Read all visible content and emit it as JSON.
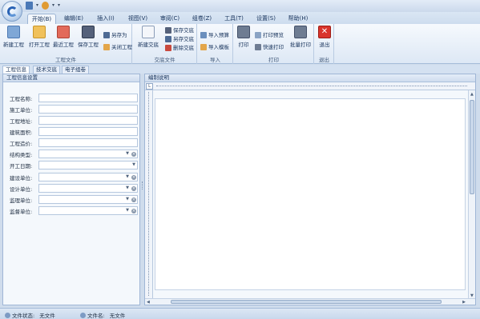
{
  "ribbon_tabs": [
    "开始(B)",
    "编辑(E)",
    "插入(I)",
    "视图(V)",
    "审阅(C)",
    "组卷(Z)",
    "工具(T)",
    "设置(S)",
    "帮助(H)"
  ],
  "groups": {
    "project_file": {
      "label": "工程文件",
      "new": "新建工程",
      "open": "打开工程",
      "recent": "最近工程",
      "save": "保存工程",
      "save_as": "另存为",
      "close": "关闭工程"
    },
    "doc_file": {
      "label": "交底文件",
      "new": "新建交底",
      "save": "保存交底",
      "save_as": "另存交底",
      "delete": "删除交底"
    },
    "import": {
      "label": "导入",
      "budget": "导入预算",
      "template": "导入模板"
    },
    "print": {
      "label": "打印",
      "print": "打印",
      "preview": "打印预览",
      "quick": "快速打印",
      "batch": "批量打印"
    },
    "exit": {
      "label": "退出",
      "exit": "退出"
    }
  },
  "doc_tabs": [
    "工程信息",
    "技术交底",
    "电子组卷"
  ],
  "left_panel": {
    "header": "工程信息设置",
    "fields": [
      {
        "label": "工程名称:",
        "value": ""
      },
      {
        "label": "施工单位:",
        "value": ""
      },
      {
        "label": "工程地址:",
        "value": ""
      },
      {
        "label": "建筑面积:",
        "value": ""
      },
      {
        "label": "工程造价:",
        "value": ""
      },
      {
        "label": "结构类型:",
        "value": ""
      },
      {
        "label": "开工日期:",
        "value": ""
      },
      {
        "label": "建设单位:",
        "value": ""
      },
      {
        "label": "设计单位:",
        "value": ""
      },
      {
        "label": "监理单位:",
        "value": ""
      },
      {
        "label": "监督单位:",
        "value": ""
      }
    ]
  },
  "right_panel": {
    "header": "编制说明"
  },
  "status": {
    "file_state_label": "文件状态:",
    "file_state_value": "无文件",
    "file_name_label": "文件名:",
    "file_name_value": "无文件"
  },
  "colors": {
    "ribbon_bg": "#dde8f5",
    "accent": "#2a63b5",
    "exit_red": "#d9342b",
    "panel_border": "#9fb6d6"
  }
}
